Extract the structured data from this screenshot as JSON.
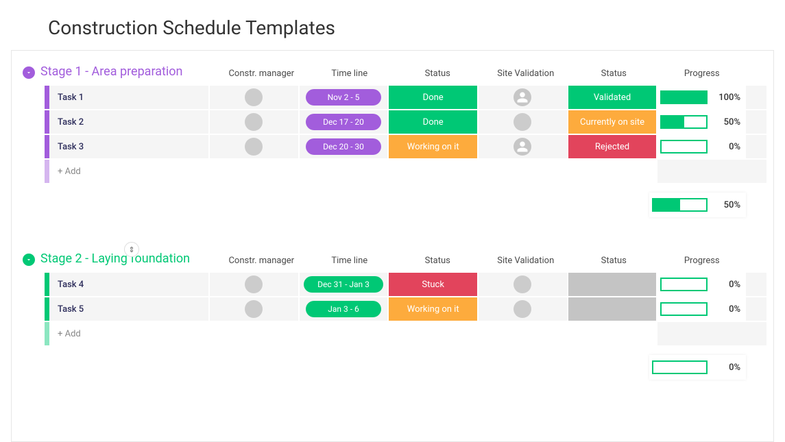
{
  "page_title": "Construction Schedule Templates",
  "columns": {
    "manager": "Constr. manager",
    "timeline": "Time line",
    "status1": "Status",
    "site_validation": "Site Validation",
    "status2": "Status",
    "progress": "Progress"
  },
  "add_label": "+ Add",
  "colors": {
    "purple_accent": "#a25ddc",
    "green_accent": "#00c875",
    "done": "#00c875",
    "working": "#fdab3d",
    "stuck": "#e2445c",
    "validated": "#00c875",
    "currently_on_site": "#fdab3d",
    "rejected": "#e2445c",
    "blank_status": "#c4c4c4",
    "timeline_purple": "#a25ddc",
    "timeline_green": "#00c875"
  },
  "groups": [
    {
      "id": "g1",
      "title": "Stage 1 - Area preparation",
      "accent": "#a25ddc",
      "title_color": "#a25ddc",
      "summary_progress": 50,
      "tasks": [
        {
          "name": "Task 1",
          "manager_avatar": "av1",
          "timeline_label": "Nov 2 - 5",
          "timeline_color": "#a25ddc",
          "status1": {
            "label": "Done",
            "color": "#00c875"
          },
          "site_validation_avatar": "empty",
          "status2": {
            "label": "Validated",
            "color": "#00c875"
          },
          "progress": 100
        },
        {
          "name": "Task 2",
          "manager_avatar": "av1",
          "timeline_label": "Dec 17 - 20",
          "timeline_color": "#a25ddc",
          "status1": {
            "label": "Done",
            "color": "#00c875"
          },
          "site_validation_avatar": "av3",
          "status2": {
            "label": "Currently on site",
            "color": "#fdab3d"
          },
          "progress": 50
        },
        {
          "name": "Task 3",
          "manager_avatar": "av2",
          "timeline_label": "Dec 20 - 30",
          "timeline_color": "#a25ddc",
          "status1": {
            "label": "Working on it",
            "color": "#fdab3d"
          },
          "site_validation_avatar": "empty",
          "status2": {
            "label": "Rejected",
            "color": "#e2445c"
          },
          "progress": 0
        }
      ]
    },
    {
      "id": "g2",
      "title": "Stage 2 - Laying foundation",
      "accent": "#00c875",
      "title_color": "#00c875",
      "summary_progress": 0,
      "show_drag_handle": true,
      "tasks": [
        {
          "name": "Task 4",
          "manager_avatar": "av2",
          "timeline_label": "Dec 31 - Jan 3",
          "timeline_color": "#00c875",
          "status1": {
            "label": "Stuck",
            "color": "#e2445c"
          },
          "site_validation_avatar": "av3",
          "status2": {
            "label": "",
            "color": "#c4c4c4"
          },
          "progress": 0
        },
        {
          "name": "Task 5",
          "manager_avatar": "av1",
          "timeline_label": "Jan 3 - 6",
          "timeline_color": "#00c875",
          "status1": {
            "label": "Working on it",
            "color": "#fdab3d"
          },
          "site_validation_avatar": "av3",
          "status2": {
            "label": "",
            "color": "#c4c4c4"
          },
          "progress": 0
        }
      ]
    }
  ]
}
